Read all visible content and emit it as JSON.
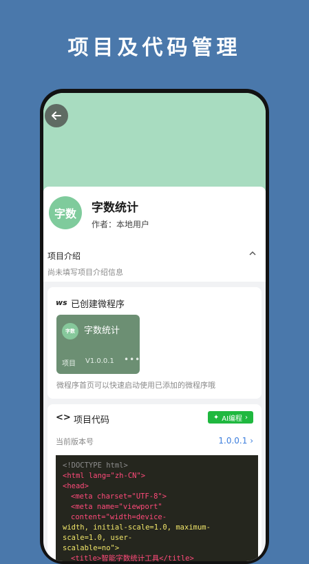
{
  "hero": {
    "title": "项目及代码管理"
  },
  "project": {
    "avatar_text": "字数",
    "name": "字数统计",
    "author": "作者：本地用户"
  },
  "intro": {
    "title": "项目介绍",
    "description": "尚未填写项目介绍信息"
  },
  "mini_program": {
    "badge": "ws",
    "title": "已创建微程序",
    "tile": {
      "avatar_text": "字数",
      "name": "字数统计",
      "type": "项目",
      "version": "V1.0.0.1",
      "more": "•••"
    },
    "hint": "微程序首页可以快速启动使用已添加的微程序哦"
  },
  "code": {
    "icon_text": "<>",
    "title": "项目代码",
    "ai_button": "AI编程",
    "version_label": "当前版本号",
    "version_value": "1.0.0.1",
    "lines": [
      "<!DOCTYPE html>",
      "<html lang=\"zh-CN\">",
      "<head>",
      "<meta charset=\"UTF-8\">",
      "<meta name=\"viewport\" content=\"width=device-",
      "width, initial-scale=1.0, maximum-scale=1.0, user-",
      "scalable=no\">",
      "<title>智能字数统计工具</title>"
    ]
  },
  "colors": {
    "background": "#4a78ab",
    "banner": "#a8dcc0",
    "accent_green": "#1fb83f",
    "link_blue": "#3b7ddd",
    "code_bg": "#25261e"
  }
}
